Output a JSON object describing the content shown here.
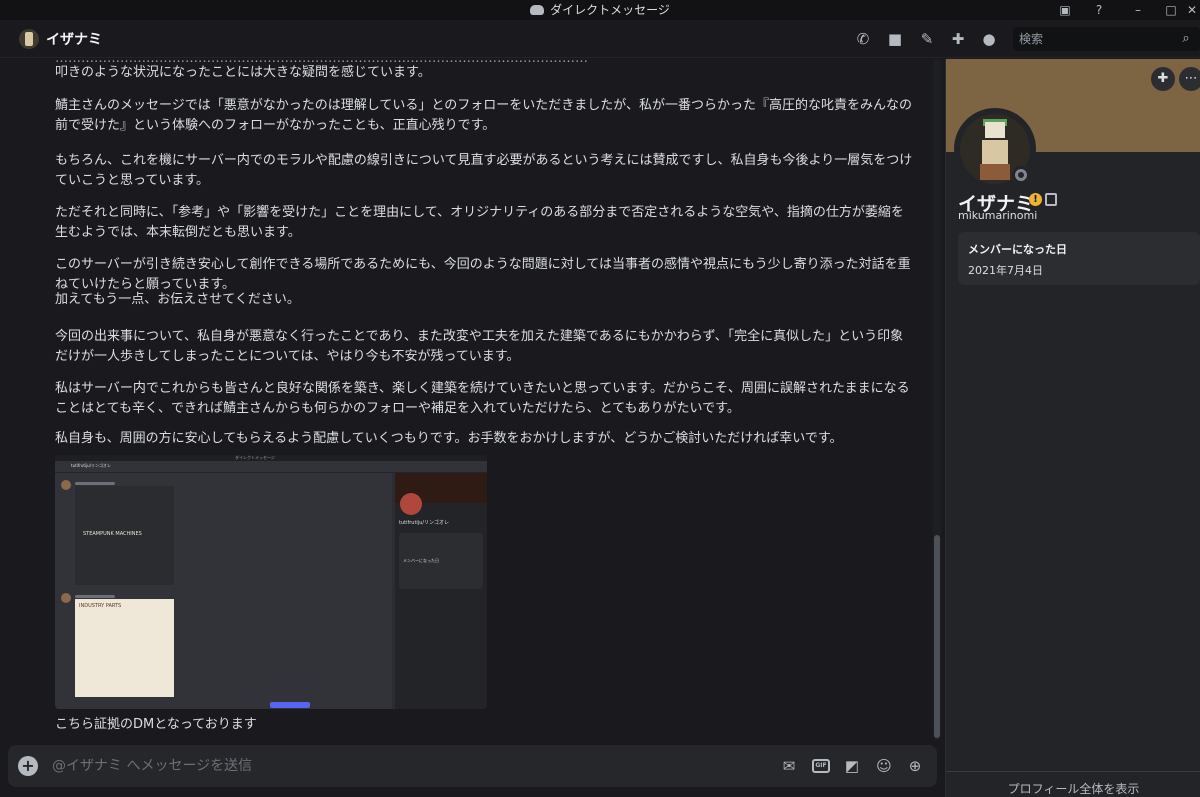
{
  "window": {
    "title": "ダイレクトメッセージ",
    "controls": [
      "minimize",
      "maximize",
      "close"
    ]
  },
  "header": {
    "username": "イザナミ",
    "search_placeholder": "検索"
  },
  "messages": {
    "cut_line": "……………………………………………………………………………………………………………",
    "p0": "叩きのような状況になったことには大きな疑問を感じています。",
    "p1": "鯖主さんのメッセージでは「悪意がなかったのは理解している」とのフォローをいただきましたが、私が一番つらかった『高圧的な叱責をみんなの前で受けた』という体験へのフォローがなかったことも、正直心残りです。",
    "p2": "もちろん、これを機にサーバー内でのモラルや配慮の線引きについて見直す必要があるという考えには賛成ですし、私自身も今後より一層気をつけていこうと思っています。",
    "p3": "ただそれと同時に、「参考」や「影響を受けた」ことを理由にして、オリジナリティのある部分まで否定されるような空気や、指摘の仕方が萎縮を生むようでは、本末転倒だとも思います。",
    "p4a": "このサーバーが引き続き安心して創作できる場所であるためにも、今回のような問題に対しては当事者の感情や視点にもう少し寄り添った対話を重ねていけたらと願っています。",
    "p4b": "加えてもう一点、お伝えさせてください。",
    "p5": "今回の出来事について、私自身が悪意なく行ったことであり、また改変や工夫を加えた建築であるにもかかわらず、「完全に真似した」という印象だけが一人歩きしてしまったことについては、やはり今も不安が残っています。",
    "p6": "私はサーバー内でこれからも皆さんと良好な関係を築き、楽しく建築を続けていきたいと思っています。だからこそ、周囲に誤解されたままになることはとても辛く、できれば鯖主さんからも何らかのフォローや補足を入れていただけたら、とてもありがたいです。",
    "p7": "私自身も、周囲の方に安心してもらえるよう配慮していくつもりです。お手数をおかけしますが、どうかご検討いただければ幸いです。",
    "caption": "こちら証拠のDMとなっております"
  },
  "embedded_screenshot": {
    "title": "ダイレクトメッセージ",
    "user": "tutifrutiju/リンゴオレ",
    "image1_text": "STEAMPUNK MACHINES",
    "image2_text": "INDUSTRY PARTS",
    "label_member_since": "メンバーになった日"
  },
  "composer": {
    "placeholder": "@イザナミ へメッセージを送信",
    "gif_label": "GIF"
  },
  "profile": {
    "display_name": "イザナミ",
    "username": "mikumarinomi",
    "member_since_label": "メンバーになった日",
    "member_since_value": "2021年7月4日",
    "view_full_profile": "プロフィール全体を表示"
  },
  "colors": {
    "background": "#1a1a1e",
    "panel": "#232428",
    "banner": "#7d6443",
    "status_offline": "#80848e",
    "warning": "#f0b232",
    "accent": "#5865f2"
  },
  "icons": {
    "titlebar": [
      "discord-icon",
      "screenshare-icon",
      "help-icon"
    ],
    "header": [
      "voice-call-icon",
      "video-call-icon",
      "pin-icon",
      "add-friend-icon",
      "profile-toggle-icon",
      "search-icon"
    ],
    "composer": [
      "attach-plus-icon",
      "gift-icon",
      "gif-icon",
      "sticker-icon",
      "emoji-icon",
      "activities-icon"
    ]
  }
}
